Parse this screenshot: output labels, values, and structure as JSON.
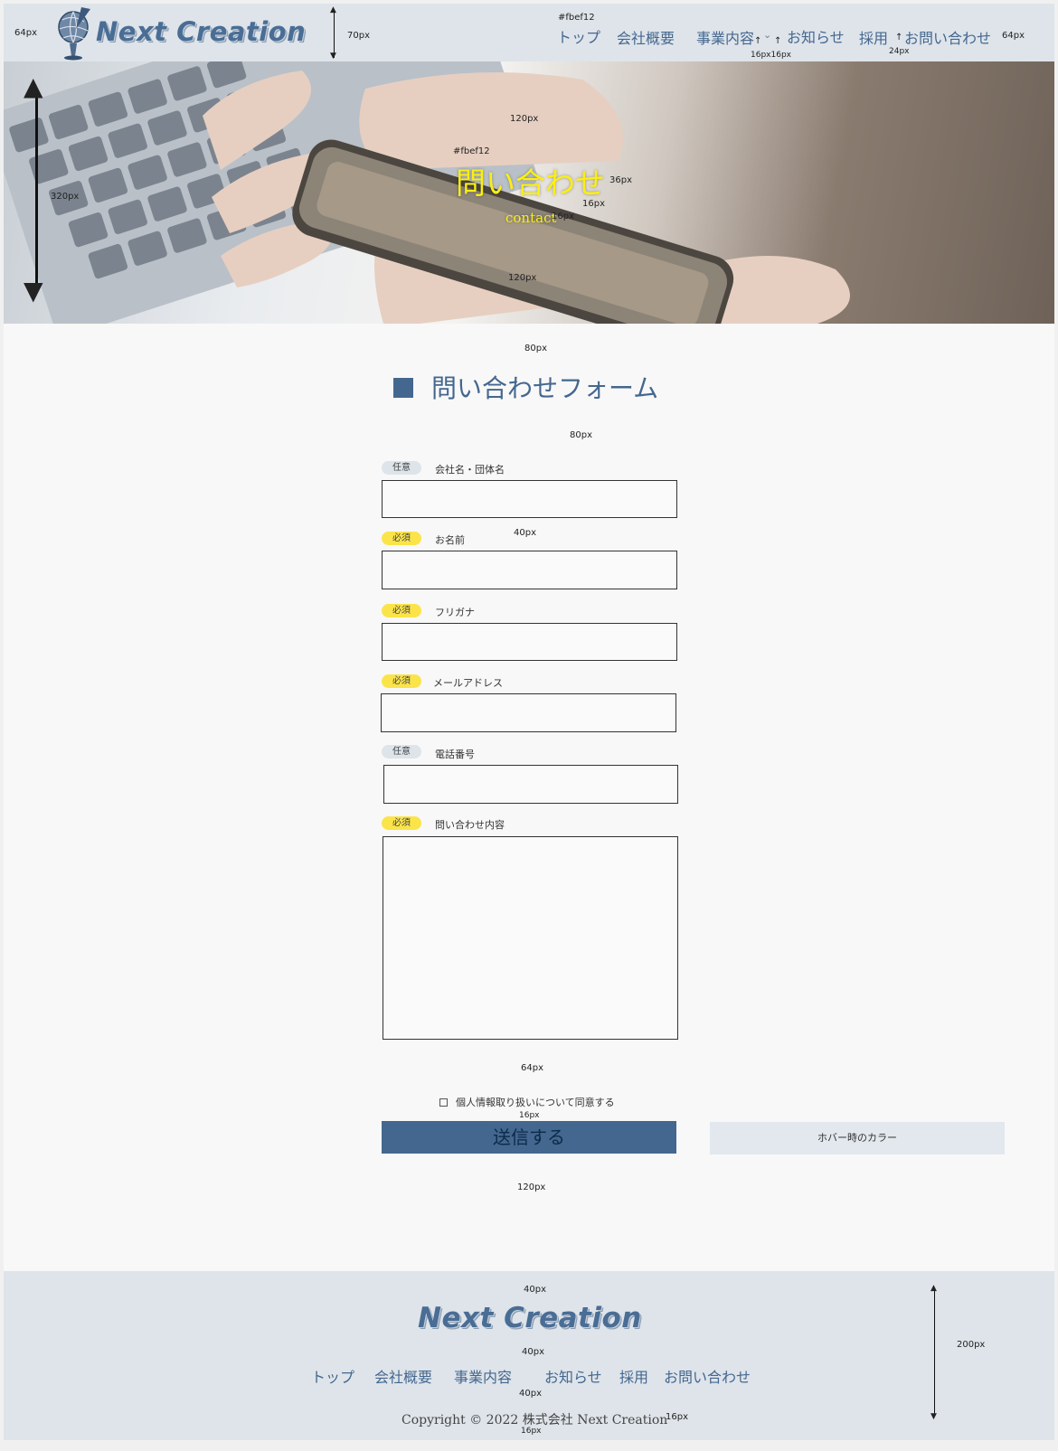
{
  "header": {
    "logo_text": "Next Creation",
    "nav": [
      "トップ",
      "会社概要",
      "事業内容",
      "お知らせ",
      "採用",
      "お問い合わせ"
    ],
    "color_note": "#fbef12"
  },
  "hero": {
    "title": "問い合わせ",
    "subtitle": "contact",
    "color_note": "#fbef12"
  },
  "form": {
    "title": "問い合わせフォーム",
    "fields": [
      {
        "badge": "任意",
        "label": "会社名・団体名"
      },
      {
        "badge": "必須",
        "label": "お名前"
      },
      {
        "badge": "必須",
        "label": "フリガナ"
      },
      {
        "badge": "必須",
        "label": "メールアドレス"
      },
      {
        "badge": "任意",
        "label": "電話番号"
      },
      {
        "badge": "必須",
        "label": "問い合わせ内容"
      }
    ],
    "checkbox_label": "個人情報取り扱いについて同意する",
    "submit_label": "送信する",
    "hover_label": "ホバー時のカラー"
  },
  "footer": {
    "logo_text": "Next Creation",
    "nav": [
      "トップ",
      "会社概要",
      "事業内容",
      "お知らせ",
      "採用",
      "お問い合わせ"
    ],
    "copyright": "Copyright © 2022 株式会社 Next Creation"
  },
  "annotations": {
    "a64px": "64px",
    "a70px": "70px",
    "a16px": "16px",
    "a16px16px": "16px16px",
    "a24px": "24px",
    "a120px": "120px",
    "a320px": "320px",
    "a36px": "36px",
    "a80px": "80px",
    "a40px": "40px",
    "a200px": "200px"
  },
  "colors": {
    "brand": "#44678f",
    "accent": "#fbef12",
    "header_bg": "#dee4ea",
    "required": "#fbe44a"
  }
}
